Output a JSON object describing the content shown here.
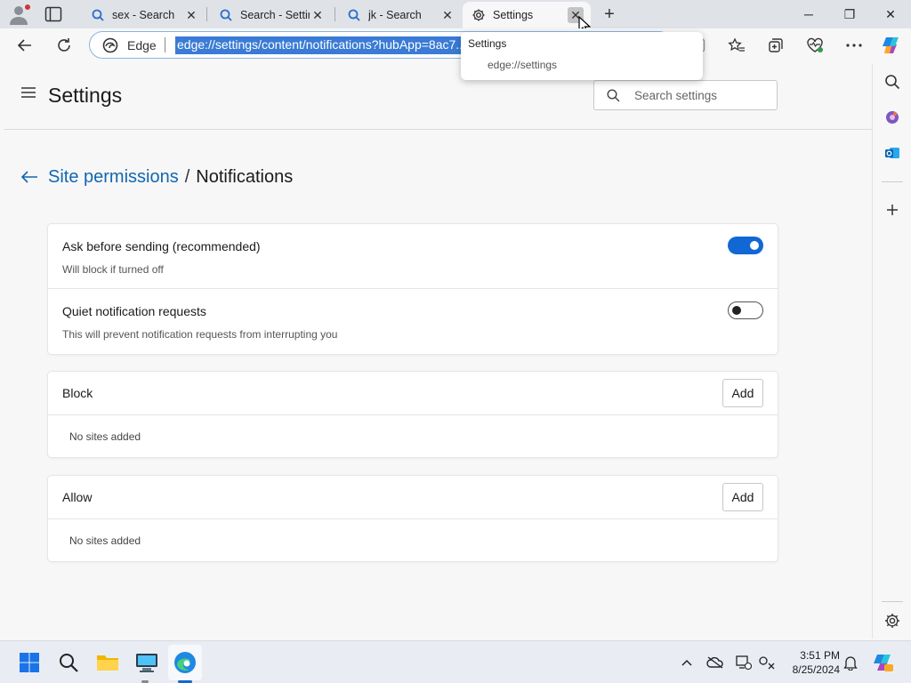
{
  "browser": {
    "tabs": [
      {
        "title": "sex - Search",
        "icon": "search-icon",
        "active": false
      },
      {
        "title": "Search - Settings",
        "icon": "search-icon",
        "active": false
      },
      {
        "title": "jk - Search",
        "icon": "search-icon",
        "active": false
      },
      {
        "title": "Settings",
        "icon": "gear-icon",
        "active": true
      }
    ],
    "new_tab_label": "+",
    "window_controls": {
      "minimize": "─",
      "restore": "❐",
      "close": "✕"
    },
    "address_bar": {
      "identity_label": "Edge",
      "url": "edge://settings/content/notifications?hubApp=8ac7..."
    },
    "tooltip": {
      "title": "Settings",
      "url": "edge://settings"
    }
  },
  "settings": {
    "title": "Settings",
    "search_placeholder": "Search settings",
    "breadcrumb": {
      "parent": "Site permissions",
      "separator": "/",
      "current": "Notifications"
    },
    "options": [
      {
        "title": "Ask before sending (recommended)",
        "subtitle": "Will block if turned off",
        "enabled": true
      },
      {
        "title": "Quiet notification requests",
        "subtitle": "This will prevent notification requests from interrupting you",
        "enabled": false
      }
    ],
    "block": {
      "title": "Block",
      "add_label": "Add",
      "empty_text": "No sites added"
    },
    "allow": {
      "title": "Allow",
      "add_label": "Add",
      "empty_text": "No sites added"
    }
  },
  "taskbar": {
    "time": "3:51 PM",
    "date": "8/25/2024"
  },
  "colors": {
    "accent": "#1167d4",
    "link": "#1167b1",
    "url_highlight": "#3a7bd5"
  }
}
